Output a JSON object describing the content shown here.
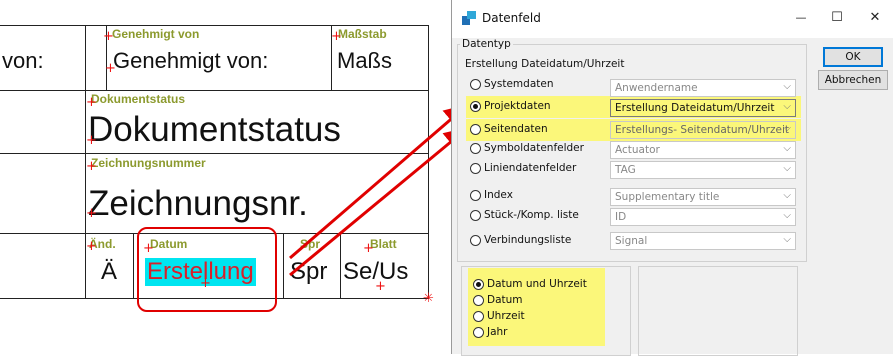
{
  "drawing": {
    "cells": {
      "genehmigt_label": "Genehmigt von",
      "massstab_label": "Maßstab",
      "von_text": "von:",
      "genehmigt_text": "Genehmigt von:",
      "mass_text": "Maßs",
      "dokumentstatus_label": "Dokumentstatus",
      "dokumentstatus_text": "Dokumentstatus",
      "zeichnungsnummer_label": "Zeichnungsnummer",
      "zeichnungsnr_text": "Zeichnungsnr.",
      "aend_label": "Änd.",
      "datum_label": "Datum",
      "spr_label": "Spr",
      "blatt_label": "Blatt",
      "ae_text": "Ä",
      "erstellung_text": "Erstellung",
      "spr_text": "Spr",
      "seus_text": "Se/Us"
    },
    "colors": {
      "label": "#8c9a2e",
      "highlight": "#00e5f0",
      "annotation": "#e00000"
    }
  },
  "dialog": {
    "title": "Datenfeld",
    "window_buttons": {
      "minimize": "—",
      "maximize": "☐",
      "close": "✕"
    },
    "group_label": "Datentyp",
    "subheading": "Erstellung Dateidatum/Uhrzeit",
    "ok_label": "OK",
    "cancel_label": "Abbrechen",
    "rows": [
      {
        "label": "Systemdaten",
        "value": "Anwendername",
        "selected": false
      },
      {
        "label": "Projektdaten",
        "value": "Erstellung Dateidatum/Uhrzeit",
        "selected": true
      },
      {
        "label": "Seitendaten",
        "value": "Erstellungs- Seitendatum/Uhrzeit",
        "selected": false
      },
      {
        "label": "Symboldatenfelder",
        "value": "Actuator",
        "selected": false
      },
      {
        "label": "Liniendatenfelder",
        "value": "TAG",
        "selected": false
      },
      {
        "label": "Index",
        "value": "Supplementary title",
        "selected": false
      },
      {
        "label": "Stück-/Komp. liste",
        "value": "ID",
        "selected": false
      },
      {
        "label": "Verbindungsliste",
        "value": "Signal",
        "selected": false
      }
    ],
    "format_options": [
      {
        "label": "Datum und Uhrzeit",
        "selected": true
      },
      {
        "label": "Datum",
        "selected": false
      },
      {
        "label": "Uhrzeit",
        "selected": false
      },
      {
        "label": "Jahr",
        "selected": false
      }
    ],
    "highlight_color": "#fbf77a"
  }
}
